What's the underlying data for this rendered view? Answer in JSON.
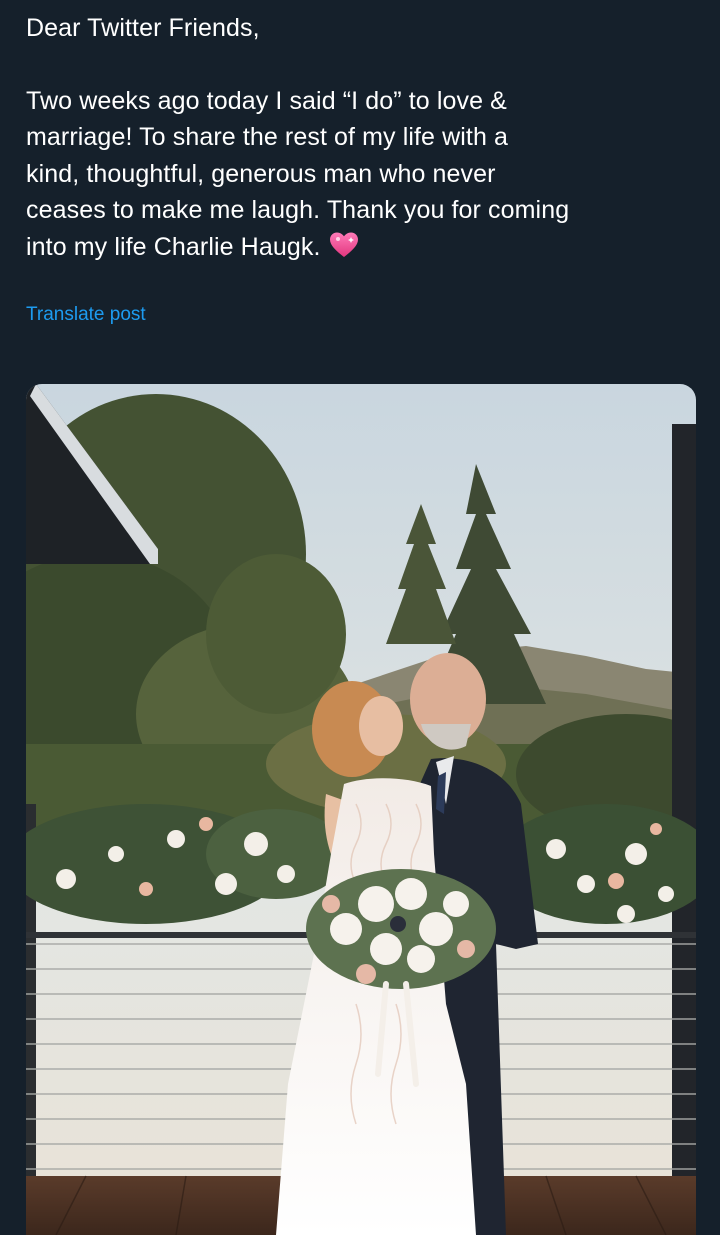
{
  "post": {
    "greeting": "Dear Twitter Friends,",
    "body_line_1": "Two weeks ago today I said “I do” to love &",
    "body_line_2": "marriage! To share the rest of my life with a",
    "body_line_3": "kind, thoughtful, generous man who never",
    "body_line_4": "ceases to make me laugh. Thank you for coming",
    "body_line_5": "into my life Charlie Haugk.",
    "emoji_icon": "sparkling-heart-icon",
    "translate_label": "Translate post"
  },
  "media": {
    "photo_icon": "wedding-photo"
  },
  "colors": {
    "background": "#15202b",
    "text": "#ffffff",
    "link": "#1d9bf0",
    "heart": "#f0569a"
  }
}
